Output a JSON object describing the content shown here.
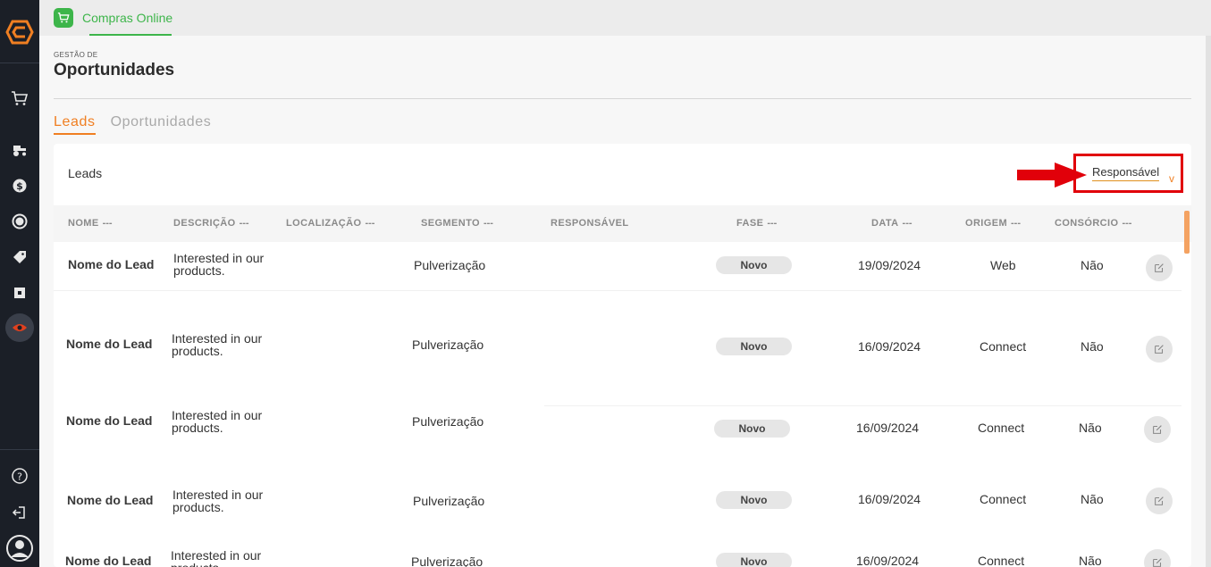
{
  "app_tab": {
    "label": "Compras Online"
  },
  "page": {
    "breadcrumb": "GESTÃO DE",
    "title": "Oportunidades"
  },
  "tabs": [
    {
      "label": "Leads",
      "active": true
    },
    {
      "label": "Oportunidades",
      "active": false
    }
  ],
  "card": {
    "title": "Leads",
    "filter_label": "Responsável",
    "filter_chevron": "v"
  },
  "columns": {
    "nome": "NOME",
    "descricao": "DESCRIÇÃO",
    "localizacao": "LOCALIZAÇÃO",
    "segmento": "SEGMENTO",
    "responsavel": "RESPONSÁVEL",
    "fase": "FASE",
    "data": "DATA",
    "origem": "ORIGEM",
    "consorcio": "CONSÓRCIO",
    "sort_dots": "---"
  },
  "rows": [
    {
      "nome": "Nome do Lead",
      "descricao": "Interested in our products.",
      "segmento": "Pulverização",
      "fase": "Novo",
      "data": "19/09/2024",
      "origem": "Web",
      "consorcio": "Não"
    },
    {
      "nome": "Nome do Lead",
      "descricao": "Interested in our products.",
      "segmento": "Pulverização",
      "fase": "Novo",
      "data": "16/09/2024",
      "origem": "Connect",
      "consorcio": "Não"
    },
    {
      "nome": "Nome do Lead",
      "descricao": "Interested in our products.",
      "segmento": "Pulverização",
      "fase": "Novo",
      "data": "16/09/2024",
      "origem": "Connect",
      "consorcio": "Não"
    },
    {
      "nome": "Nome do Lead",
      "descricao": "Interested in our products.",
      "segmento": "Pulverização",
      "fase": "Novo",
      "data": "16/09/2024",
      "origem": "Connect",
      "consorcio": "Não"
    },
    {
      "nome": "Nome do Lead",
      "descricao": "Interested in our products.",
      "segmento": "Pulverização",
      "fase": "Novo",
      "data": "16/09/2024",
      "origem": "Connect",
      "consorcio": "Não"
    }
  ],
  "sidebar": {
    "icons": [
      "cart-icon",
      "tractor-icon",
      "dollar-icon",
      "refresh-dollar-icon",
      "tag-icon",
      "ticket-icon",
      "eye-icon",
      "help-icon",
      "logout-icon",
      "user-avatar-icon"
    ]
  },
  "colors": {
    "accent": "#f07f22",
    "brand_green": "#3db54a",
    "sidebar_bg": "#1b1f27",
    "highlight_red": "#e1000a"
  }
}
